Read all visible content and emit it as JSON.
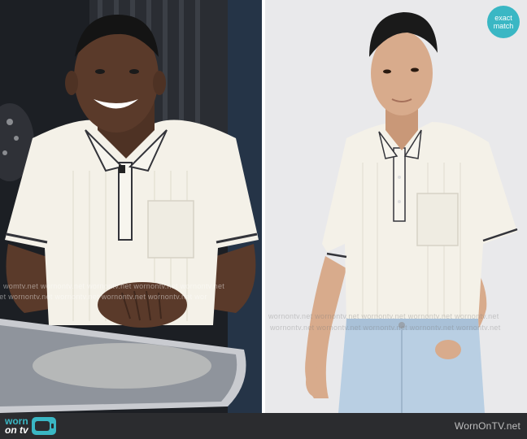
{
  "watermark": {
    "left_rows": [
      "womtv.net  wornontv.net  wornontv.net  wornontv.net  wornontv.net",
      "net  wornontv.net  wornontv.net  wornontv.net  wornontv.net  wor"
    ],
    "right_rows": [
      "wornontv.net  wornontv.net  wornontv.net  wornontv.net  wornontv.net",
      "wornontv.net  wornontv.net  wornontv.net  wornontv.net  wornontv.net"
    ]
  },
  "badge": {
    "line1": "exact",
    "line2": "match",
    "color": "#3ab7c4"
  },
  "footer": {
    "logo_line1": "worn",
    "logo_line2": "on tv",
    "site": "WornOnTV.net",
    "accent": "#3ab7c4"
  },
  "colors": {
    "shirt": "#f4f1e8",
    "shirt_trim": "#33343a",
    "skin_dark": "#5a3a2a",
    "skin_light": "#d8ab8c",
    "jeans": "#b9cfe3",
    "table": "#c9cbd0"
  }
}
